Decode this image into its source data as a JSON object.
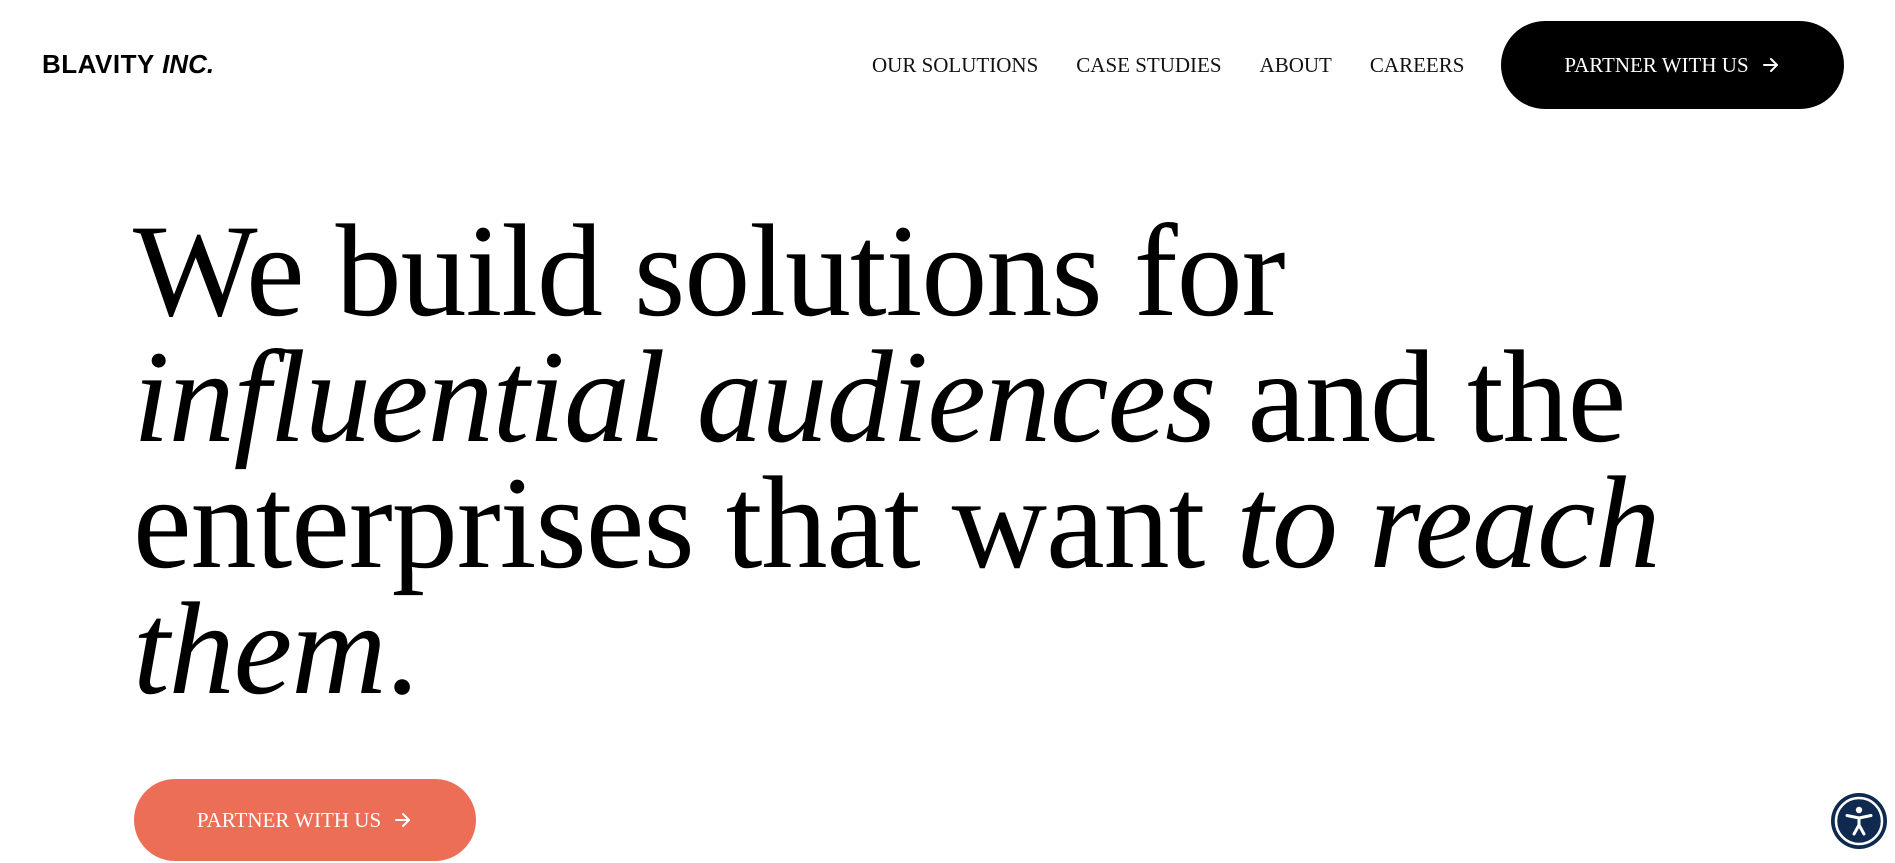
{
  "header": {
    "logo_main": "BLAVITY ",
    "logo_inc": "INC.",
    "nav": [
      {
        "label": "OUR SOLUTIONS"
      },
      {
        "label": "CASE STUDIES"
      },
      {
        "label": "ABOUT"
      },
      {
        "label": "CAREERS"
      }
    ],
    "cta_label": "PARTNER WITH US"
  },
  "hero": {
    "line1": "We build solutions for",
    "line2_italic": "influential audiences",
    "line2_rest": " and the",
    "line3_regular": "enterprises that want ",
    "line3_italic": "to reach",
    "line4_italic": "them",
    "line4_period": ".",
    "cta_label": "PARTNER WITH US"
  },
  "colors": {
    "top_cta_bg": "#000000",
    "hero_cta_bg": "#ec6e57",
    "accessibility_bg": "#0f2a4e"
  },
  "icons": {
    "cta_arrow": "arrow-right-icon",
    "accessibility": "accessibility-icon"
  }
}
